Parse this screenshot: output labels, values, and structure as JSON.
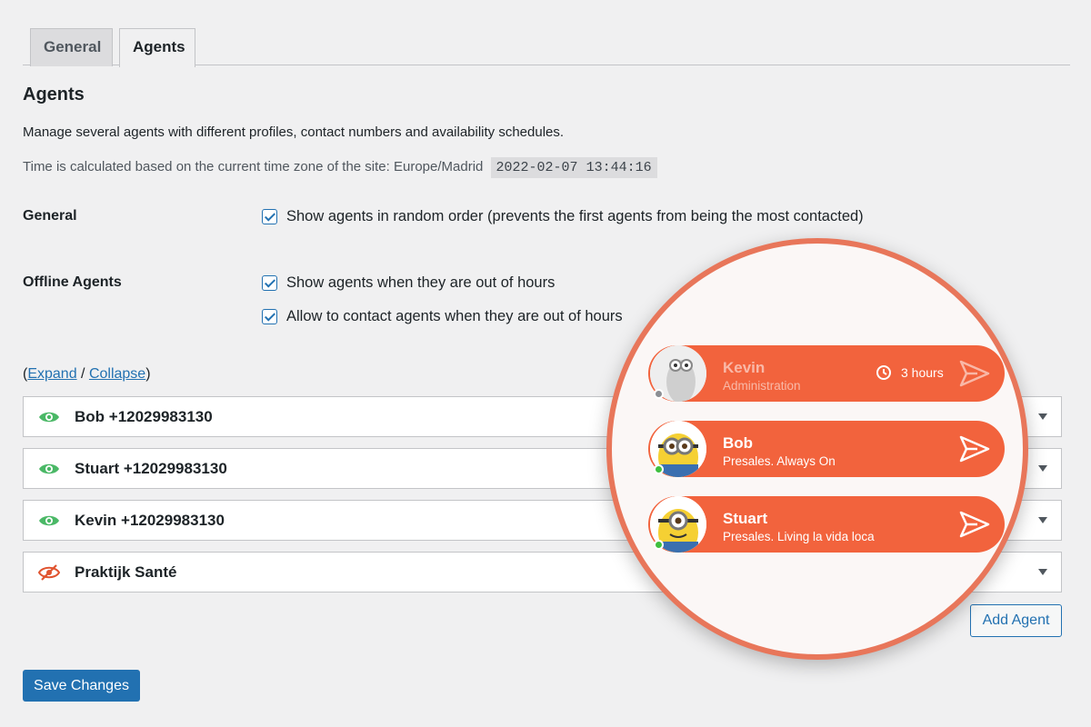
{
  "tabs": [
    {
      "label": "General",
      "active": false
    },
    {
      "label": "Agents",
      "active": true
    }
  ],
  "page_title": "Agents",
  "description": "Manage several agents with different profiles, contact numbers and availability schedules.",
  "timezone": {
    "text": "Time is calculated based on the current time zone of the site: Europe/Madrid",
    "datetime": "2022-02-07 13:44:16"
  },
  "general": {
    "label": "General",
    "random_order_label": "Show agents in random order (prevents the first agents from being the most contacted)"
  },
  "offline": {
    "label": "Offline Agents",
    "show_label": "Show agents when they are out of hours",
    "allow_label": "Allow to contact agents when they are out of hours"
  },
  "expand_collapse": {
    "open": "(",
    "expand": "Expand",
    "sep": " / ",
    "collapse": "Collapse",
    "close": ")"
  },
  "agents": [
    {
      "name": "Bob +12029983130",
      "visible": true
    },
    {
      "name": "Stuart +12029983130",
      "visible": true
    },
    {
      "name": "Kevin +12029983130",
      "visible": true
    },
    {
      "name": "Praktijk Santé",
      "visible": false
    }
  ],
  "buttons": {
    "add_agent": "Add Agent",
    "save": "Save Changes"
  },
  "preview": [
    {
      "name": "Kevin",
      "role": "Administration",
      "status": "offline",
      "hours": "3 hours"
    },
    {
      "name": "Bob",
      "role": "Presales. Always On",
      "status": "online"
    },
    {
      "name": "Stuart",
      "role": "Presales. Living la vida loca",
      "status": "online"
    }
  ],
  "colors": {
    "accent": "#2271b1",
    "pill": "#f2633d",
    "ring": "#e8765a",
    "online": "#3fbf3f",
    "offline": "#8c8f94",
    "eye_on": "#4ab866",
    "eye_off": "#e0532f"
  },
  "icons": {
    "visible": "eye-icon",
    "hidden": "eye-slash-icon",
    "send": "send-icon",
    "clock": "clock-icon",
    "caret": "caret-down-icon"
  }
}
